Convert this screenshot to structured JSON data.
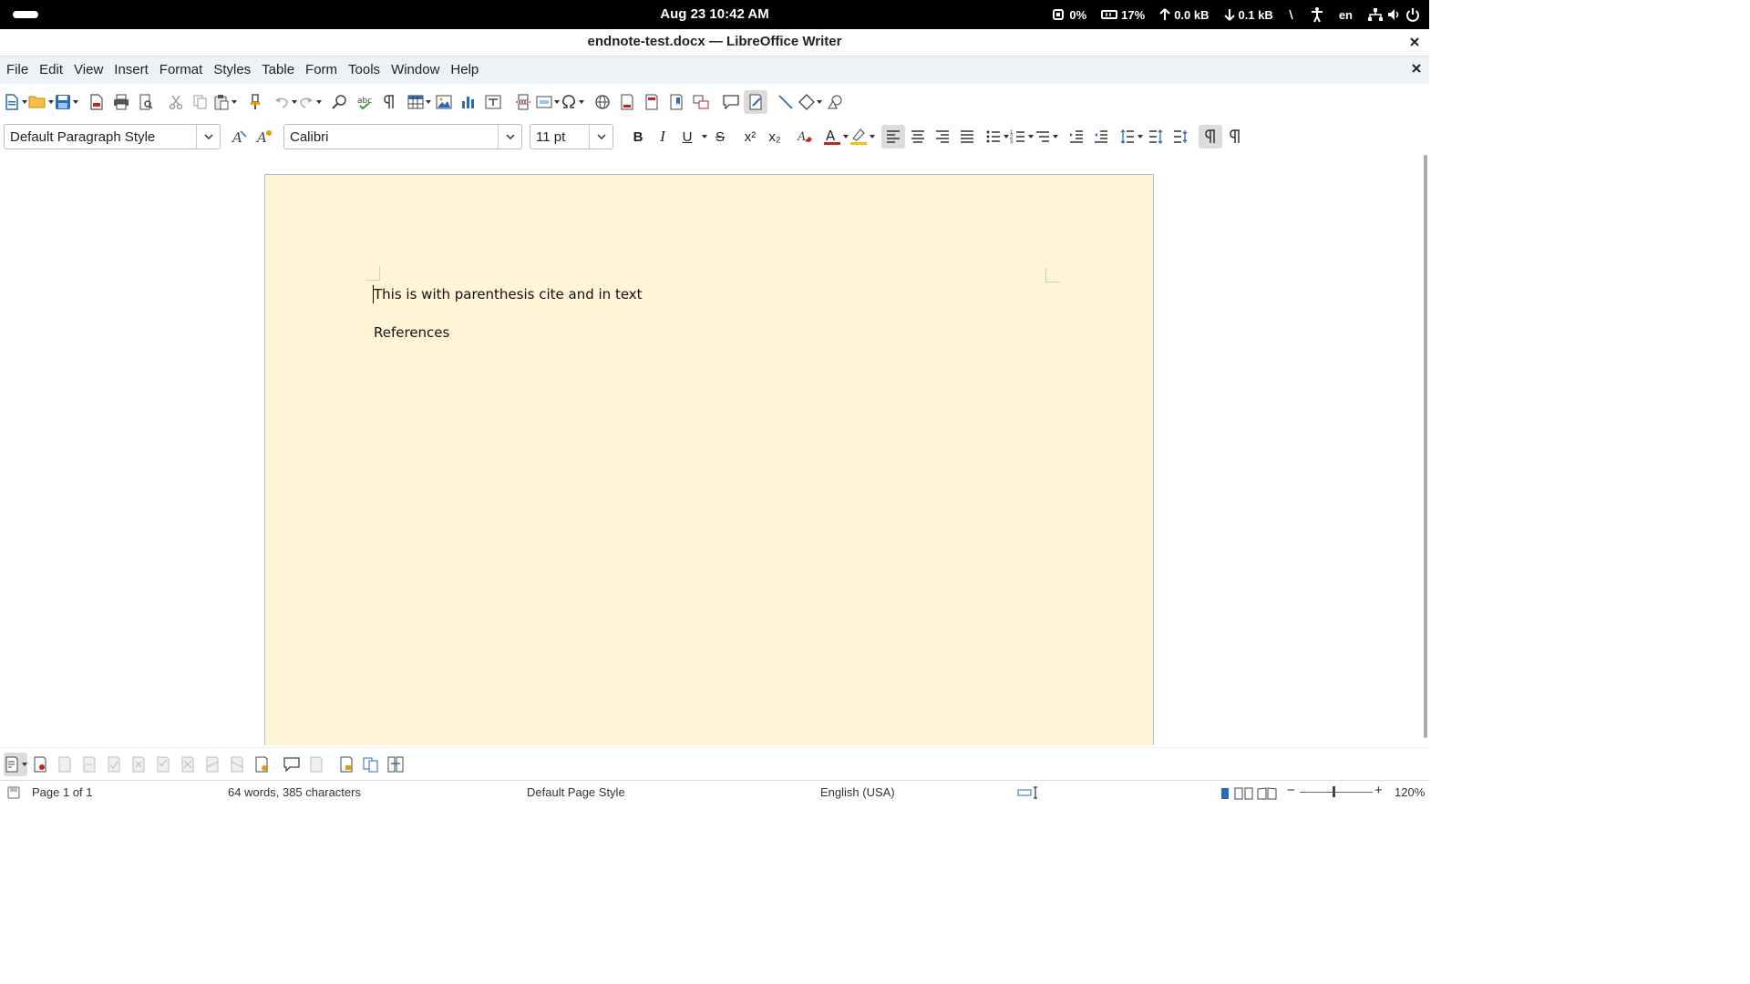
{
  "system_bar": {
    "clock": "Aug 23  10:42 AM",
    "cpu": "0%",
    "memory": "17%",
    "upload": "0.0 kB",
    "download": "0.1 kB",
    "language": "en",
    "icons": [
      "activities-pill",
      "cpu-icon",
      "memory-icon",
      "upload-arrow-icon",
      "download-arrow-icon",
      "accessibility-icon",
      "network-icon",
      "volume-icon",
      "power-icon"
    ]
  },
  "window": {
    "title": "endnote-test.docx — LibreOffice Writer"
  },
  "menu": [
    "File",
    "Edit",
    "View",
    "Insert",
    "Format",
    "Styles",
    "Table",
    "Form",
    "Tools",
    "Window",
    "Help"
  ],
  "format_toolbar": {
    "paragraph_style": "Default Paragraph Style",
    "font_name": "Calibri",
    "font_size": "11 pt",
    "bold": "B",
    "italic": "I",
    "underline": "U",
    "strikethrough": "S",
    "superscript": "x²",
    "subscript": "x₂",
    "font_color": "#c9211e",
    "highlight_color": "#ffbf00"
  },
  "document": {
    "paragraphs": [
      "This is with parenthesis cite  and in text",
      "References"
    ],
    "page_color": "#fff4d6"
  },
  "status_bar": {
    "page": "Page 1 of 1",
    "words": "64 words, 385 characters",
    "page_style": "Default Page Style",
    "language": "English (USA)",
    "zoom": "120%",
    "zoom_minus": "−",
    "zoom_plus": "+"
  }
}
